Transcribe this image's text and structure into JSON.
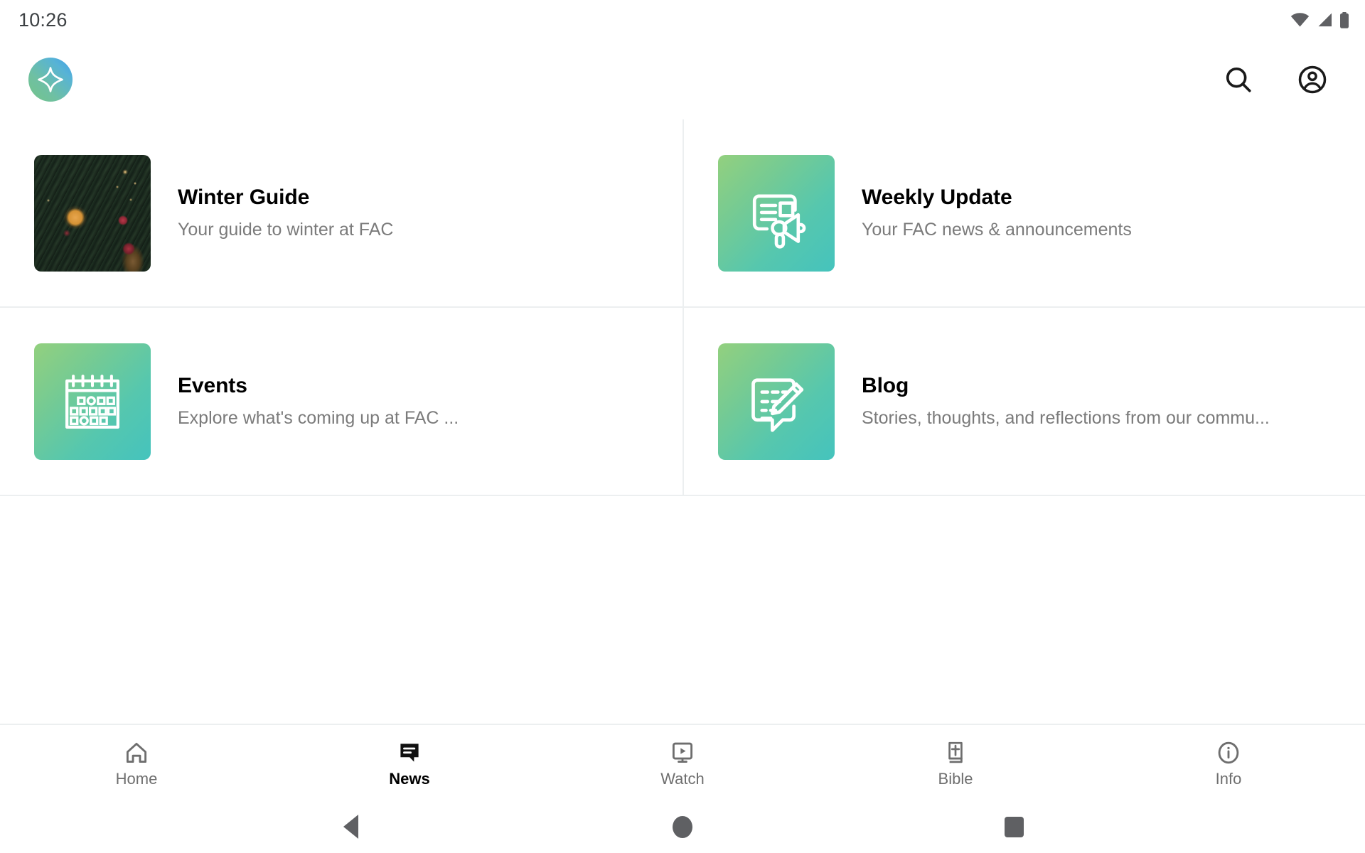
{
  "status_bar": {
    "time": "10:26",
    "icons": [
      "wifi-icon",
      "cellular-icon",
      "battery-icon"
    ]
  },
  "header": {
    "logo": "app-logo-sparkle-icon",
    "actions": [
      {
        "name": "search-icon",
        "label": "Search"
      },
      {
        "name": "account-circle-icon",
        "label": "Account"
      }
    ]
  },
  "colors": {
    "accent_gradient_start": "#93d07e",
    "accent_gradient_end": "#45c3bd",
    "logo_gradient_start": "#74c48a",
    "logo_gradient_end": "#3f9fe8",
    "divider": "#eceff0",
    "title": "#000000",
    "subtitle": "#7b7b7b",
    "nav_inactive": "#6e6e6e",
    "nav_active": "#000000",
    "system_nav": "#5f6063"
  },
  "main": {
    "cards": [
      {
        "title": "Winter Guide",
        "subtitle": "Your guide to winter at FAC",
        "thumb_type": "photo",
        "thumb_icon": "winter-foliage-photo"
      },
      {
        "title": "Weekly Update",
        "subtitle": "Your FAC news & announcements",
        "thumb_type": "gradient",
        "thumb_icon": "newspaper-megaphone-icon"
      },
      {
        "title": "Events",
        "subtitle": "Explore what's coming up at FAC ...",
        "thumb_type": "gradient",
        "thumb_icon": "calendar-icon"
      },
      {
        "title": "Blog",
        "subtitle": "Stories, thoughts, and reflections from our commu...",
        "thumb_type": "gradient",
        "thumb_icon": "speech-bubble-pencil-icon"
      }
    ]
  },
  "bottom_nav": {
    "active_index": 1,
    "items": [
      {
        "label": "Home",
        "icon": "home-icon"
      },
      {
        "label": "News",
        "icon": "news-speech-bubble-icon"
      },
      {
        "label": "Watch",
        "icon": "monitor-play-icon"
      },
      {
        "label": "Bible",
        "icon": "bible-book-cross-icon"
      },
      {
        "label": "Info",
        "icon": "info-circle-icon"
      }
    ]
  },
  "system_nav": {
    "buttons": [
      {
        "name": "android-back-button",
        "label": "Back"
      },
      {
        "name": "android-home-button",
        "label": "Home"
      },
      {
        "name": "android-recents-button",
        "label": "Recents"
      }
    ]
  }
}
